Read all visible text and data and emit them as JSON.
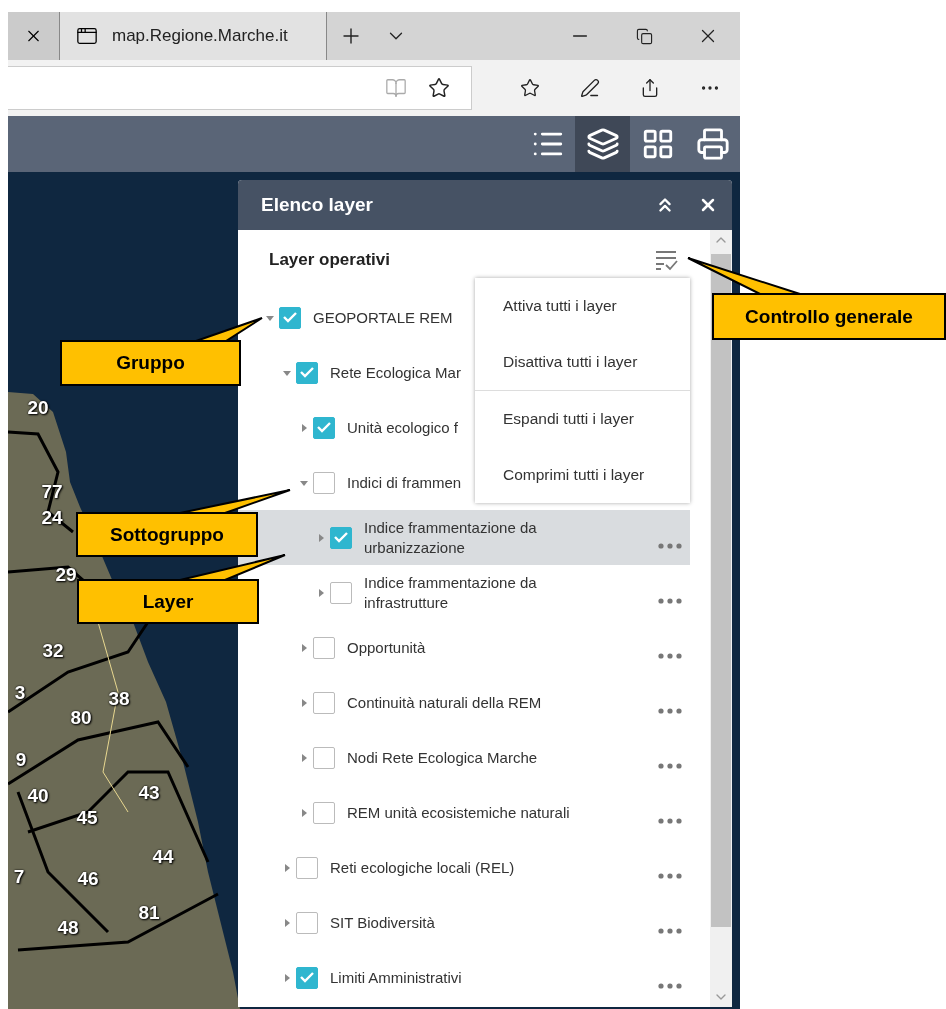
{
  "browser": {
    "tabs": [
      {
        "selected": false
      },
      {
        "title": "map.Regione.Marche.it",
        "selected": true
      }
    ]
  },
  "toolbar": {
    "tools": [
      {
        "kind": "list",
        "selected": false
      },
      {
        "kind": "layers",
        "selected": true
      },
      {
        "kind": "grid",
        "selected": false
      },
      {
        "kind": "print",
        "selected": false
      }
    ]
  },
  "map": {
    "labels": [
      "20",
      "77",
      "24",
      "29",
      "32",
      "3",
      "38",
      "80",
      "9",
      "40",
      "43",
      "45",
      "44",
      "7",
      "46",
      "81",
      "48"
    ]
  },
  "panel": {
    "title": "Elenco layer",
    "section_title": "Layer operativi",
    "menu": {
      "groups": [
        [
          "Attiva tutti i layer",
          "Disattiva tutti i layer"
        ],
        [
          "Espandi tutti i layer",
          "Comprimi tutti i layer"
        ]
      ]
    },
    "tree": [
      {
        "label": "GEOPORTALE REM",
        "checked": true,
        "expanded": true,
        "selected": false,
        "children": [
          {
            "label": "Rete Ecologica Mar",
            "checked": true,
            "expanded": true,
            "selected": false,
            "children": [
              {
                "label": "Unità ecologico f",
                "checked": true,
                "expanded": false,
                "selected": false
              },
              {
                "label": "Indici di frammen",
                "checked": false,
                "expanded": true,
                "selected": false,
                "children": [
                  {
                    "label": "Indice frammentazione da urbanizzazione",
                    "checked": true,
                    "expanded": false,
                    "selected": true
                  },
                  {
                    "label": "Indice frammentazione da infrastrutture",
                    "checked": false,
                    "expanded": false,
                    "selected": false
                  }
                ]
              },
              {
                "label": "Opportunità",
                "checked": false,
                "expanded": false,
                "selected": false
              },
              {
                "label": "Continuità naturali della REM",
                "checked": false,
                "expanded": false,
                "selected": false
              },
              {
                "label": "Nodi Rete Ecologica Marche",
                "checked": false,
                "expanded": false,
                "selected": false
              },
              {
                "label": "REM unità ecosistemiche naturali",
                "checked": false,
                "expanded": false,
                "selected": false
              }
            ]
          },
          {
            "label": "Reti ecologiche locali (REL)",
            "checked": false,
            "expanded": false,
            "selected": false
          },
          {
            "label": "SIT Biodiversità",
            "checked": false,
            "expanded": false,
            "selected": false
          },
          {
            "label": "Limiti Amministrativi",
            "checked": true,
            "expanded": false,
            "selected": false
          }
        ]
      }
    ]
  },
  "callouts": [
    {
      "text": "Controllo generale"
    },
    {
      "text": "Gruppo"
    },
    {
      "text": "Sottogruppo"
    },
    {
      "text": "Layer"
    }
  ]
}
